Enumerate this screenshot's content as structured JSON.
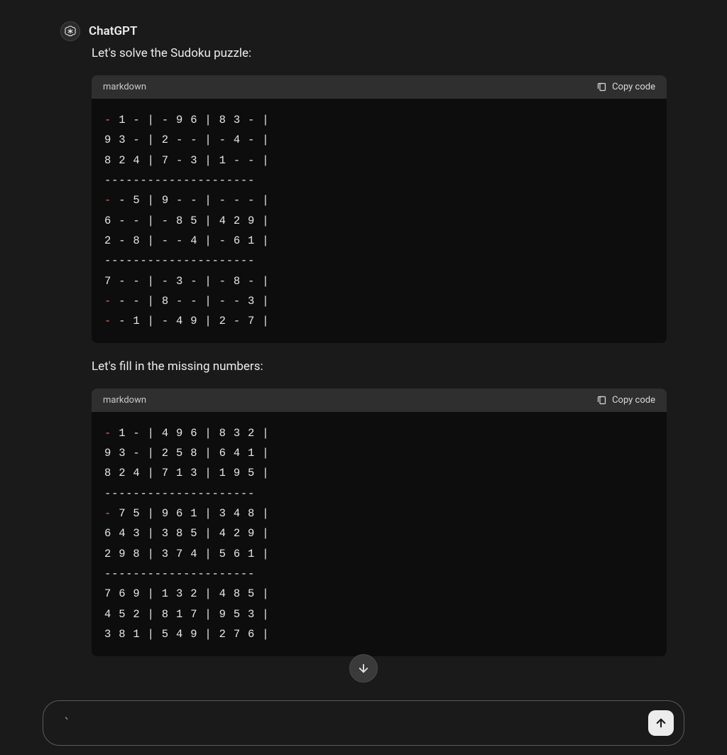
{
  "message": {
    "sender": "ChatGPT",
    "intro": "Let's solve the Sudoku puzzle:",
    "followup": "Let's fill in the missing numbers:"
  },
  "codeblocks": {
    "block1": {
      "language": "markdown",
      "copy_label": "Copy code",
      "lines": [
        {
          "bullet": "-",
          "rest": " 1 - | - 9 6 | 8 3 - |"
        },
        {
          "bullet": "",
          "rest": "9 3 - | 2 - - | - 4 - |"
        },
        {
          "bullet": "",
          "rest": "8 2 4 | 7 - 3 | 1 - - |"
        },
        {
          "bullet": "",
          "rest": "---------------------"
        },
        {
          "bullet": "-",
          "rest": " - 5 | 9 - - | - - - |"
        },
        {
          "bullet": "",
          "rest": "6 - - | - 8 5 | 4 2 9 |"
        },
        {
          "bullet": "",
          "rest": "2 - 8 | - - 4 | - 6 1 |"
        },
        {
          "bullet": "",
          "rest": "---------------------"
        },
        {
          "bullet": "",
          "rest": "7 - - | - 3 - | - 8 - |"
        },
        {
          "bullet": "-",
          "rest": " - - | 8 - - | - - 3 |"
        },
        {
          "bullet": "-",
          "rest": " - 1 | - 4 9 | 2 - 7 |"
        }
      ]
    },
    "block2": {
      "language": "markdown",
      "copy_label": "Copy code",
      "lines": [
        {
          "bullet": "-",
          "rest": " 1 - | 4 9 6 | 8 3 2 |"
        },
        {
          "bullet": "",
          "rest": "9 3 - | 2 5 8 | 6 4 1 |"
        },
        {
          "bullet": "",
          "rest": "8 2 4 | 7 1 3 | 1 9 5 |"
        },
        {
          "bullet": "",
          "rest": "---------------------"
        },
        {
          "bullet": "-",
          "rest": " 7 5 | 9 6 1 | 3 4 8 |"
        },
        {
          "bullet": "",
          "rest": "6 4 3 | 3 8 5 | 4 2 9 |"
        },
        {
          "bullet": "",
          "rest": "2 9 8 | 3 7 4 | 5 6 1 |"
        },
        {
          "bullet": "",
          "rest": "---------------------"
        },
        {
          "bullet": "",
          "rest": "7 6 9 | 1 3 2 | 4 8 5 |"
        },
        {
          "bullet": "",
          "rest": "4 5 2 | 8 1 7 | 9 5 3 |"
        },
        {
          "bullet": "",
          "rest": "3 8 1 | 5 4 9 | 2 7 6 |"
        }
      ]
    }
  },
  "input": {
    "value": "`"
  }
}
